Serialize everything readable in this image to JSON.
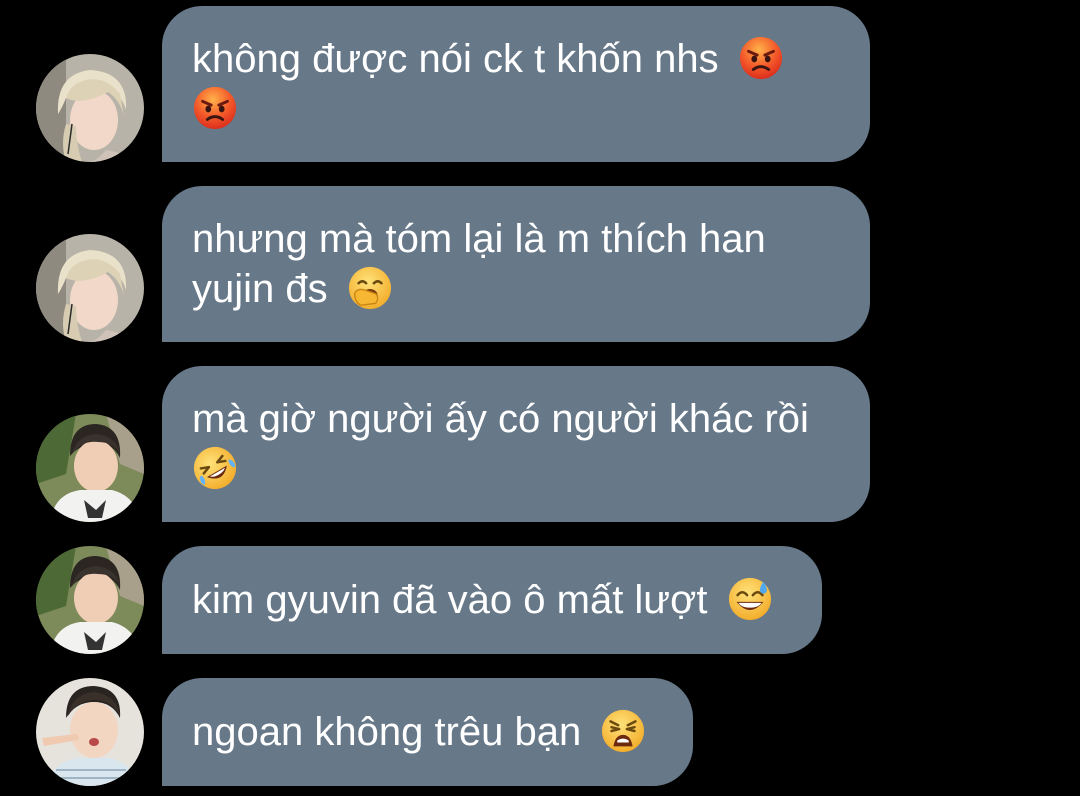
{
  "messages": [
    {
      "text_line1": "không được nói ck t khốn nhs",
      "text_line2": "",
      "emojis": [
        "angry-face-icon",
        "angry-face-icon"
      ],
      "avatar": "avatar-blonde-hair"
    },
    {
      "text_line1": "nhưng mà tóm lại là m thích han",
      "text_line2": "yujin đs",
      "emojis": [
        "yawning-face-icon"
      ],
      "avatar": "avatar-blonde-hair"
    },
    {
      "text_line1": "mà giờ người ấy có người khác rồi",
      "text_line2": "",
      "emojis": [
        "rolling-on-floor-laughing-icon"
      ],
      "avatar": "avatar-dark-hair-white-shirt"
    },
    {
      "text_line1": "kim gyuvin đã vào ô mất lượt",
      "text_line2": "",
      "emojis": [
        "grinning-sweat-icon"
      ],
      "avatar": "avatar-dark-hair-white-shirt"
    },
    {
      "text_line1": "ngoan không trêu bạn",
      "text_line2": "",
      "emojis": [
        "weary-face-icon"
      ],
      "avatar": "avatar-finger-on-cheek"
    }
  ],
  "colors": {
    "background": "#000000",
    "bubble": "#677889",
    "text": "#ffffff"
  }
}
